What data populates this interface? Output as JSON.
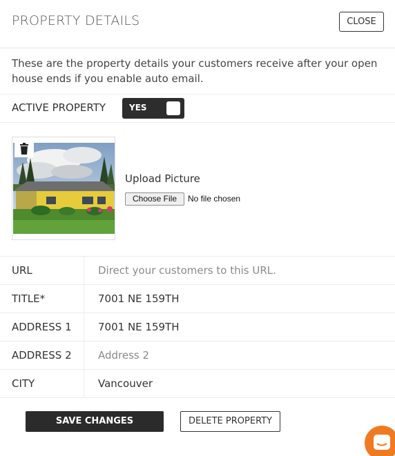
{
  "header": {
    "title": "PROPERTY DETAILS",
    "close_label": "CLOSE"
  },
  "description": "These are the property details your customers receive after your open house ends if you enable auto email.",
  "active_property": {
    "label": "ACTIVE PROPERTY",
    "toggle_label": "YES",
    "enabled": true
  },
  "upload": {
    "label": "Upload Picture",
    "button_label": "Choose File",
    "status": "No file chosen"
  },
  "fields": {
    "url": {
      "label": "URL",
      "value": "",
      "placeholder": "Direct your customers to this URL."
    },
    "title": {
      "label": "TITLE*",
      "value": "7001 NE 159TH"
    },
    "address1": {
      "label": "ADDRESS 1",
      "value": "7001 NE 159TH"
    },
    "address2": {
      "label": "ADDRESS 2",
      "value": "",
      "placeholder": "Address 2"
    },
    "city": {
      "label": "CITY",
      "value": "Vancouver"
    }
  },
  "actions": {
    "save_label": "SAVE CHANGES",
    "delete_label": "DELETE PROPERTY"
  },
  "icons": {
    "trash": "trash-icon",
    "chat": "chat-icon"
  },
  "colors": {
    "dark": "#2b2b2b",
    "chat_accent": "#f07a22"
  }
}
